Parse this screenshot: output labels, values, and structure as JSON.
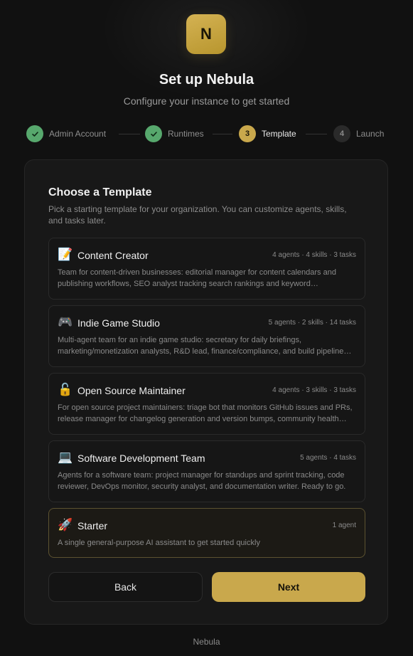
{
  "logo": {
    "letter": "N"
  },
  "header": {
    "title": "Set up Nebula",
    "subtitle": "Configure your instance to get started"
  },
  "steps": [
    {
      "number": "1",
      "label": "Admin Account",
      "status": "complete",
      "icon": "check-icon"
    },
    {
      "number": "2",
      "label": "Runtimes",
      "status": "complete",
      "icon": "check-icon"
    },
    {
      "number": "3",
      "label": "Template",
      "status": "active"
    },
    {
      "number": "4",
      "label": "Launch",
      "status": "pending"
    }
  ],
  "card": {
    "title": "Choose a Template",
    "description": "Pick a starting template for your organization. You can customize agents, skills, and tasks later."
  },
  "templates": [
    {
      "icon": "📝",
      "icon_name": "memo-icon",
      "name": "Content Creator",
      "meta": "4 agents · 4 skills · 3 tasks",
      "description": "Team for content-driven businesses: editorial manager for content calendars and publishing workflows, SEO analyst tracking search rankings and keyword opportunities.",
      "selected": false
    },
    {
      "icon": "🎮",
      "icon_name": "game-controller-icon",
      "name": "Indie Game Studio",
      "meta": "5 agents · 2 skills · 14 tasks",
      "description": "Multi-agent team for an indie game studio: secretary for daily briefings, marketing/monetization analysts, R&D lead, finance/compliance, and build pipeline monitoring.",
      "selected": false
    },
    {
      "icon": "🔓",
      "icon_name": "unlocked-padlock-icon",
      "name": "Open Source Maintainer",
      "meta": "4 agents · 3 skills · 3 tasks",
      "description": "For open source project maintainers: triage bot that monitors GitHub issues and PRs, release manager for changelog generation and version bumps, community health tracking.",
      "selected": false
    },
    {
      "icon": "💻",
      "icon_name": "laptop-icon",
      "name": "Software Development Team",
      "meta": "5 agents · 4 tasks",
      "description": "Agents for a software team: project manager for standups and sprint tracking, code reviewer, DevOps monitor, security analyst, and documentation writer. Ready to go.",
      "selected": false
    },
    {
      "icon": "🚀",
      "icon_name": "rocket-icon",
      "name": "Starter",
      "meta": "1 agent",
      "description": "A single general-purpose AI assistant to get started quickly",
      "selected": true
    }
  ],
  "buttons": {
    "back": "Back",
    "next": "Next"
  },
  "footer": {
    "text": "Nebula"
  },
  "colors": {
    "accent": "#c9a84c",
    "success": "#57a86d",
    "background": "#111111",
    "card": "#181818"
  }
}
